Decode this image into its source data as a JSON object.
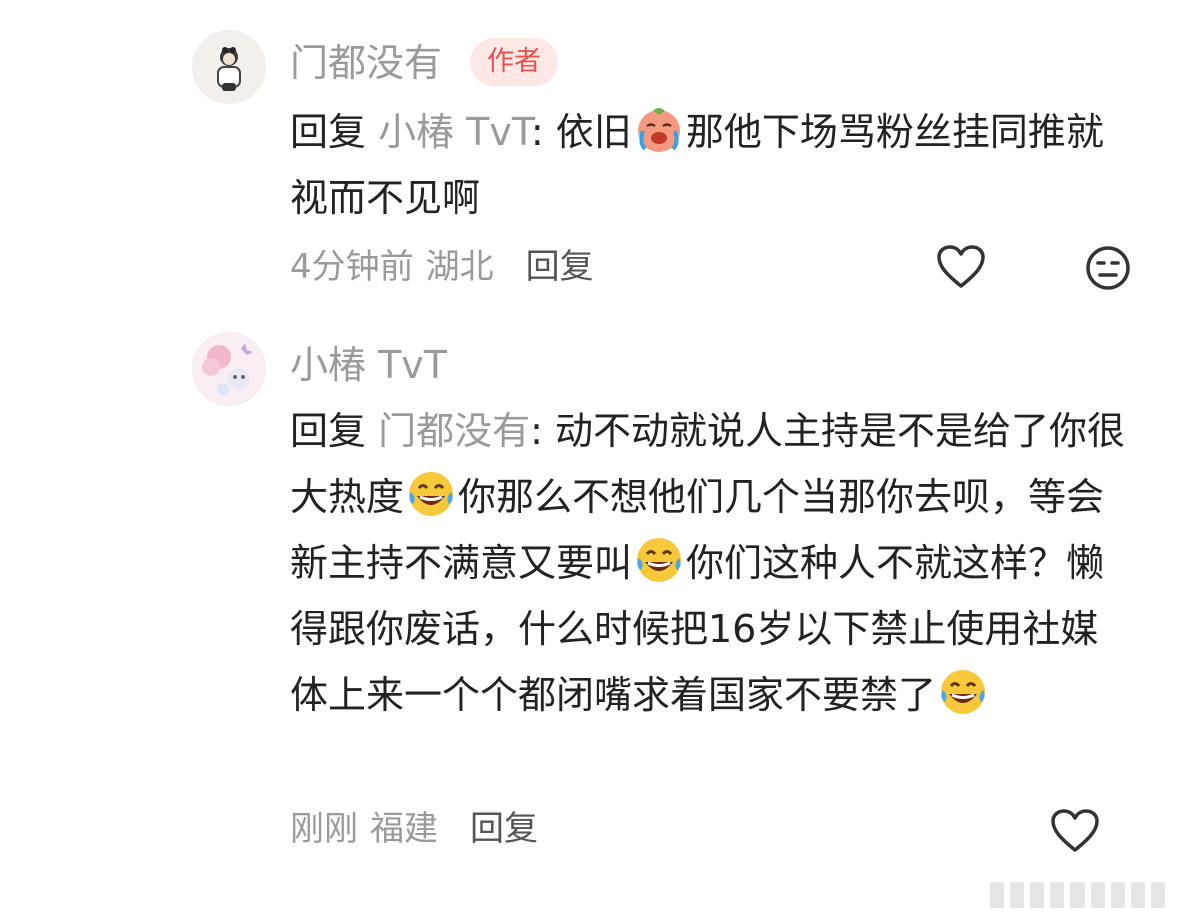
{
  "comments": [
    {
      "username": "门都没有",
      "badge": "作者",
      "reply_prefix": "回复 ",
      "reply_target": "小椿 TvT",
      "text_parts": [
        ": 依旧",
        "那他下场骂粉丝挂同推就视而不见啊"
      ],
      "emoji_names": [
        "crying-face-emoji"
      ],
      "time": "4分钟前",
      "location": "湖北",
      "reply_label": "回复"
    },
    {
      "username": "小椿 TvT",
      "reply_prefix": "回复 ",
      "reply_target": "门都没有",
      "text_parts": [
        ": 动不动就说人主持是不是给了你很大热度",
        "你那么不想他们几个当那你去呗，等会新主持不满意又要叫",
        "你们这种人不就这样？懒得跟你废话，什么时候把16岁以下禁止使用社媒体上来一个个都闭嘴求着国家不要禁了"
      ],
      "emoji_names": [
        "laughing-tears-emoji",
        "laughing-tears-emoji",
        "laughing-tears-emoji"
      ],
      "time": "刚刚",
      "location": "福建",
      "reply_label": "回复"
    }
  ],
  "icons": {
    "like": "heart-outline-icon",
    "dislike": "meh-face-icon"
  },
  "colors": {
    "badge_bg": "#fde8e6",
    "badge_text": "#e9524a",
    "muted_text": "#9a9a9a"
  }
}
